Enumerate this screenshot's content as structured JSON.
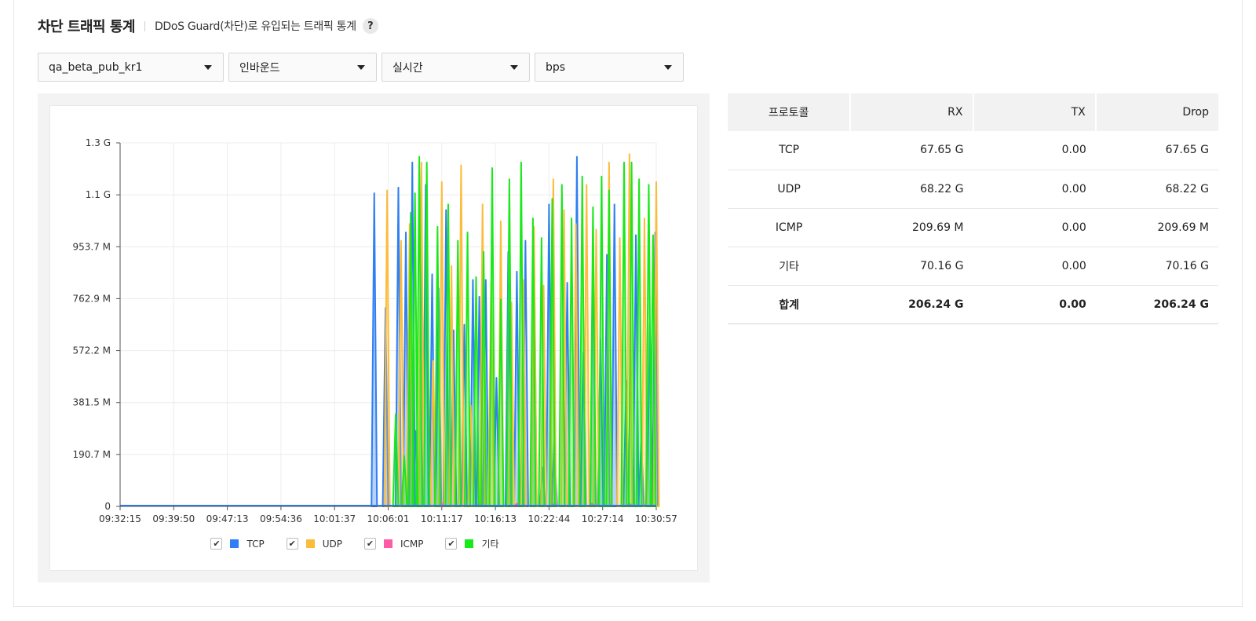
{
  "header": {
    "title": "차단 트래픽 통계",
    "description": "DDoS Guard(차단)로 유입되는 트래픽 통계",
    "help_label": "?"
  },
  "filters": {
    "resource": "qa_beta_pub_kr1",
    "direction": "인바운드",
    "period": "실시간",
    "unit": "bps"
  },
  "chart_data": {
    "type": "line",
    "y_ticks": [
      "0",
      "190.7 M",
      "381.5 M",
      "572.2 M",
      "762.9 M",
      "953.7 M",
      "1.1 G",
      "1.3 G"
    ],
    "x_ticks": [
      "09:32:15",
      "09:39:50",
      "09:47:13",
      "09:54:36",
      "10:01:37",
      "10:06:01",
      "10:11:17",
      "10:16:13",
      "10:22:44",
      "10:27:14",
      "10:30:57"
    ],
    "ylim": [
      0,
      1.3
    ],
    "y_unit": "G",
    "grid": true,
    "legend_position": "bottom",
    "series": [
      {
        "name": "TCP",
        "color": "#2f7ef3",
        "spikes": [
          [
            4.74,
            1.12
          ],
          [
            4.95,
            0.71
          ],
          [
            5.19,
            1.14
          ],
          [
            5.33,
            0.98
          ],
          [
            5.45,
            1.23
          ],
          [
            5.51,
            0.27
          ],
          [
            5.62,
            1.0
          ],
          [
            5.7,
            1.15
          ],
          [
            5.82,
            0.83
          ],
          [
            5.94,
            0.78
          ],
          [
            6.08,
            1.06
          ],
          [
            6.22,
            0.63
          ],
          [
            6.42,
            0.65
          ],
          [
            6.58,
            0.81
          ],
          [
            6.7,
            0.75
          ],
          [
            6.82,
            0.81
          ],
          [
            7.02,
            0.46
          ],
          [
            7.24,
            0.91
          ],
          [
            7.4,
            0.84
          ],
          [
            7.56,
            0.95
          ],
          [
            7.72,
            0.92
          ],
          [
            7.88,
            0.14
          ],
          [
            8.0,
            1.08
          ],
          [
            8.1,
            0.23
          ],
          [
            8.34,
            0.8
          ],
          [
            8.52,
            1.25
          ],
          [
            8.64,
            0.55
          ],
          [
            8.82,
            0.93
          ],
          [
            8.96,
            0.6
          ],
          [
            9.08,
            0.9
          ],
          [
            9.22,
            1.08
          ],
          [
            9.44,
            0.45
          ],
          [
            9.62,
            0.97
          ],
          [
            9.72,
            0.23
          ],
          [
            9.88,
            0.65
          ],
          [
            9.98,
            0.98
          ]
        ]
      },
      {
        "name": "UDP",
        "color": "#fcbc3b",
        "spikes": [
          [
            4.98,
            1.13
          ],
          [
            5.24,
            0.95
          ],
          [
            5.4,
            1.01
          ],
          [
            5.62,
            1.23
          ],
          [
            5.84,
            0.52
          ],
          [
            6.0,
            1.16
          ],
          [
            6.18,
            0.86
          ],
          [
            6.36,
            1.22
          ],
          [
            6.54,
            0.36
          ],
          [
            6.76,
            1.08
          ],
          [
            6.92,
            0.8
          ],
          [
            7.1,
            1.02
          ],
          [
            7.3,
            0.73
          ],
          [
            7.52,
            0.81
          ],
          [
            7.72,
            1.0
          ],
          [
            7.9,
            0.79
          ],
          [
            8.08,
            1.17
          ],
          [
            8.28,
            1.06
          ],
          [
            8.5,
            1.01
          ],
          [
            8.7,
            1.15
          ],
          [
            8.88,
            0.99
          ],
          [
            9.12,
            1.23
          ],
          [
            9.32,
            0.96
          ],
          [
            9.5,
            1.26
          ],
          [
            9.78,
            1.03
          ],
          [
            10.0,
            1.16
          ]
        ]
      },
      {
        "name": "ICMP",
        "color": "#ff5ca8",
        "spikes": [
          [
            6.0,
            0.01
          ],
          [
            6.7,
            0.01
          ],
          [
            7.4,
            0.01
          ],
          [
            8.1,
            0.01
          ],
          [
            8.8,
            0.01
          ],
          [
            9.5,
            0.01
          ]
        ]
      },
      {
        "name": "기타",
        "color": "#19e819",
        "spikes": [
          [
            5.14,
            0.33
          ],
          [
            5.3,
            0.18
          ],
          [
            5.42,
            1.05
          ],
          [
            5.5,
            1.12
          ],
          [
            5.58,
            1.25
          ],
          [
            5.72,
            1.23
          ],
          [
            5.92,
            1.0
          ],
          [
            6.12,
            1.08
          ],
          [
            6.3,
            0.95
          ],
          [
            6.48,
            0.98
          ],
          [
            6.64,
            0.82
          ],
          [
            6.78,
            0.91
          ],
          [
            6.94,
            1.21
          ],
          [
            7.1,
            0.74
          ],
          [
            7.26,
            1.17
          ],
          [
            7.48,
            1.23
          ],
          [
            7.7,
            1.03
          ],
          [
            7.86,
            0.96
          ],
          [
            8.06,
            1.1
          ],
          [
            8.24,
            1.15
          ],
          [
            8.42,
            1.03
          ],
          [
            8.62,
            1.18
          ],
          [
            8.82,
            1.07
          ],
          [
            8.98,
            1.18
          ],
          [
            9.12,
            1.13
          ],
          [
            9.4,
            1.23
          ],
          [
            9.54,
            1.23
          ],
          [
            9.68,
            1.17
          ],
          [
            9.86,
            1.15
          ],
          [
            9.94,
            0.97
          ]
        ]
      }
    ]
  },
  "legend": [
    {
      "label": "TCP",
      "color": "#2f7ef3",
      "checked": true
    },
    {
      "label": "UDP",
      "color": "#fcbc3b",
      "checked": true
    },
    {
      "label": "ICMP",
      "color": "#ff5ca8",
      "checked": true
    },
    {
      "label": "기타",
      "color": "#19e819",
      "checked": true
    }
  ],
  "check_mark": "✔",
  "table": {
    "headers": [
      "프로토콜",
      "RX",
      "TX",
      "Drop"
    ],
    "rows": [
      [
        "TCP",
        "67.65 G",
        "0.00",
        "67.65 G"
      ],
      [
        "UDP",
        "68.22 G",
        "0.00",
        "68.22 G"
      ],
      [
        "ICMP",
        "209.69 M",
        "0.00",
        "209.69 M"
      ],
      [
        "기타",
        "70.16 G",
        "0.00",
        "70.16 G"
      ]
    ],
    "total": [
      "합계",
      "206.24 G",
      "0.00",
      "206.24 G"
    ]
  }
}
